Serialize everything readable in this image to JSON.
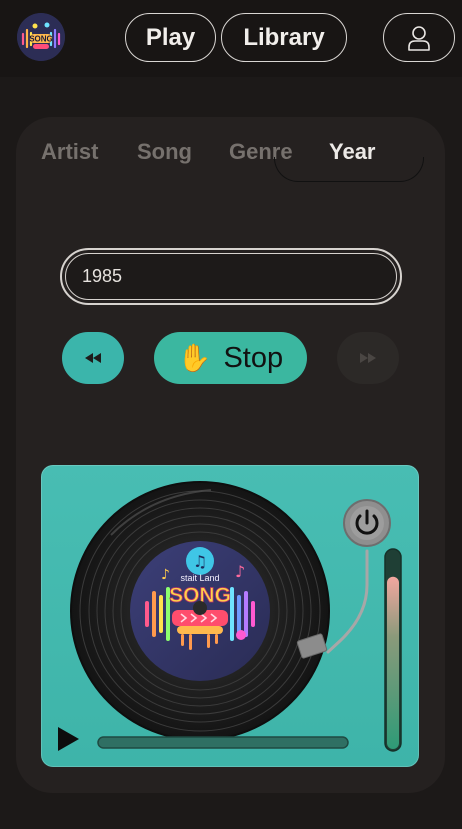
{
  "header": {
    "logo_text": "SONG",
    "play_label": "Play",
    "library_label": "Library",
    "profile_icon": "user-icon"
  },
  "tabs": [
    {
      "label": "Artist",
      "active": false
    },
    {
      "label": "Song",
      "active": false
    },
    {
      "label": "Genre",
      "active": false
    },
    {
      "label": "Year",
      "active": true
    }
  ],
  "year_input": {
    "value": "1985"
  },
  "controls": {
    "prev_icon": "rewind-icon",
    "stop_label": "Stop",
    "stop_emoji": "✋",
    "next_icon": "fast-forward-icon"
  },
  "player": {
    "record_label_top": "stait Land",
    "record_label_title": "SONG",
    "power_icon": "power-icon",
    "play_icon": "play-icon",
    "progress": 0,
    "volume": 0.87
  },
  "colors": {
    "accent_teal": "#3bb5ab",
    "stop_green": "#3bb7a0",
    "background": "#1c1918",
    "card": "#252120"
  }
}
